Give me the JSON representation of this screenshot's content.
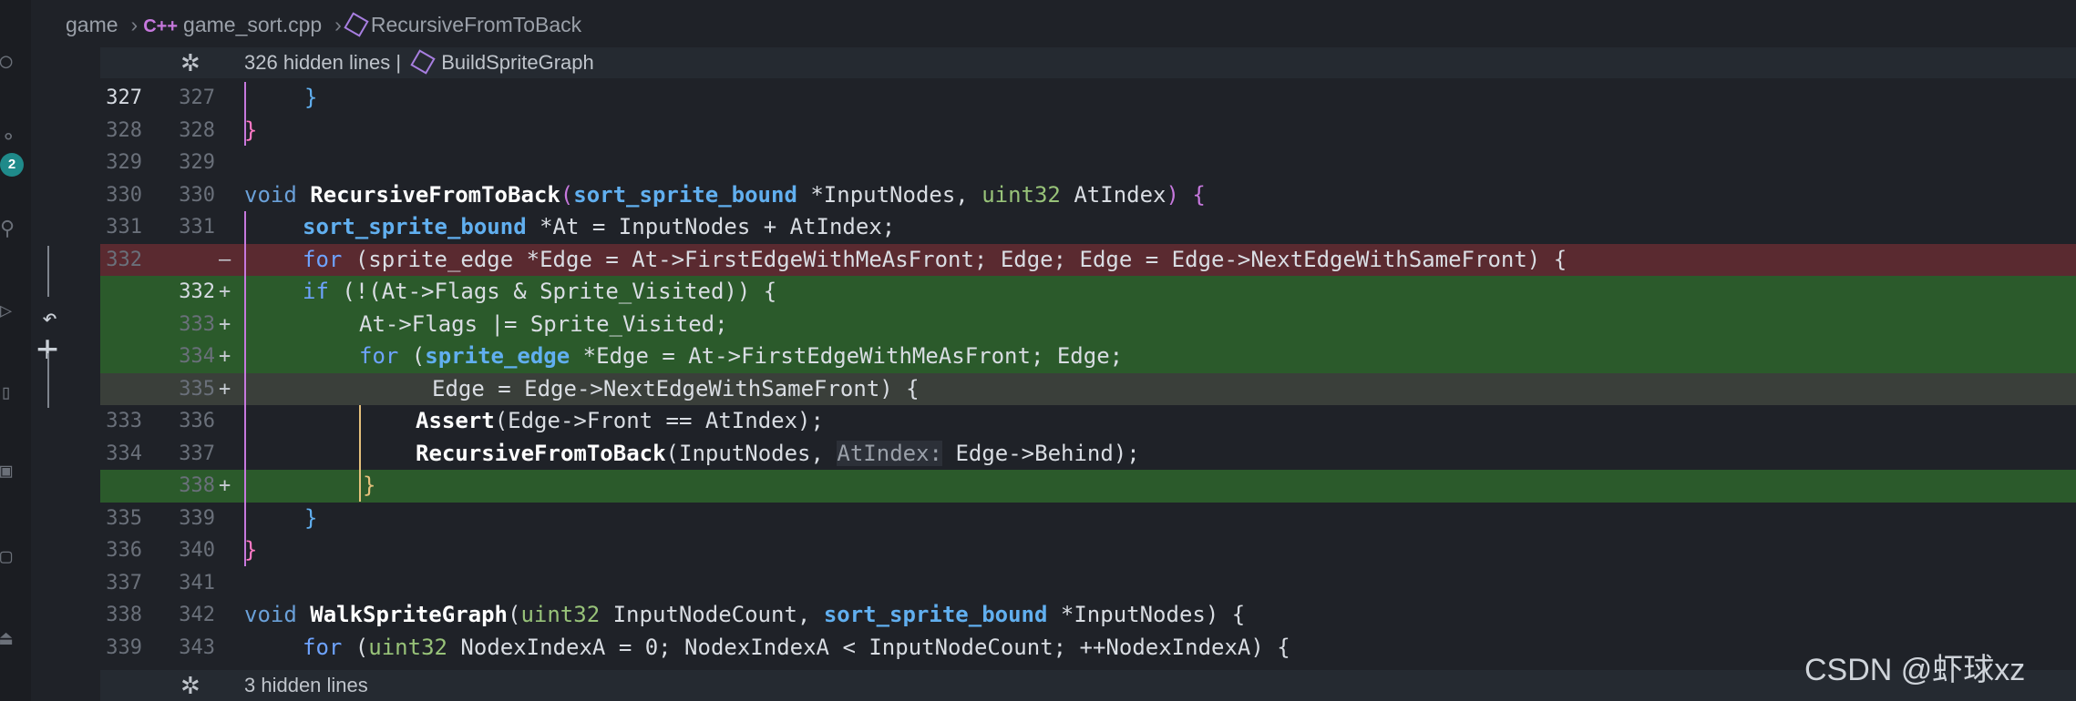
{
  "breadcrumb": {
    "folder": "game",
    "file": "game_sort.cpp",
    "symbol": "RecursiveFromToBack",
    "file_icon": "C++"
  },
  "folds": {
    "top": {
      "text": "326 hidden lines  |",
      "symbol": "BuildSpriteGraph"
    },
    "bottom": {
      "text": "3 hidden lines"
    }
  },
  "activity": {
    "badge_count": "2"
  },
  "lines": [
    {
      "old": "327",
      "new": "327",
      "sign": "",
      "type": "normal",
      "active": true
    },
    {
      "old": "328",
      "new": "328",
      "sign": "",
      "type": "normal"
    },
    {
      "old": "329",
      "new": "329",
      "sign": "",
      "type": "normal"
    },
    {
      "old": "330",
      "new": "330",
      "sign": "",
      "type": "normal"
    },
    {
      "old": "331",
      "new": "331",
      "sign": "",
      "type": "normal"
    },
    {
      "old": "332",
      "new": "",
      "sign": "—",
      "type": "del"
    },
    {
      "old": "",
      "new": "332",
      "sign": "+",
      "type": "add",
      "active": true
    },
    {
      "old": "",
      "new": "333",
      "sign": "+",
      "type": "add"
    },
    {
      "old": "",
      "new": "334",
      "sign": "+",
      "type": "add2"
    },
    {
      "old": "",
      "new": "335",
      "sign": "+",
      "type": "add2"
    },
    {
      "old": "333",
      "new": "336",
      "sign": "",
      "type": "normal"
    },
    {
      "old": "334",
      "new": "337",
      "sign": "",
      "type": "normal"
    },
    {
      "old": "",
      "new": "338",
      "sign": "+",
      "type": "add"
    },
    {
      "old": "335",
      "new": "339",
      "sign": "",
      "type": "normal"
    },
    {
      "old": "336",
      "new": "340",
      "sign": "",
      "type": "normal"
    },
    {
      "old": "337",
      "new": "341",
      "sign": "",
      "type": "normal"
    },
    {
      "old": "338",
      "new": "342",
      "sign": "",
      "type": "normal"
    },
    {
      "old": "339",
      "new": "343",
      "sign": "",
      "type": "normal"
    }
  ],
  "code": {
    "l327": "}",
    "l328": "}",
    "l330_void": "void",
    "l330_fn": "RecursiveFromToBack",
    "l330_t1": "sort_sprite_bound",
    "l330_p1": "*InputNodes,",
    "l330_t2": "uint32",
    "l330_p2": "AtIndex",
    "l331_t": "sort_sprite_bound",
    "l331_rest": "*At = InputNodes + AtIndex;",
    "l332_for": "for",
    "l332_rest": "(sprite_edge *Edge = At->FirstEdgeWithMeAsFront; Edge; Edge = Edge->NextEdgeWithSameFront) {",
    "n332_if": "if",
    "n332_rest": "(!(At->Flags & Sprite_Visited)) {",
    "n333": "At->Flags |= Sprite_Visited;",
    "n334_for": "for",
    "n334_t": "sprite_edge",
    "n334_rest": "*Edge = At->FirstEdgeWithMeAsFront; Edge;",
    "n335": "Edge = Edge->NextEdgeWithSameFront) {",
    "n336_fn": "Assert",
    "n336_rest": "(Edge->Front == AtIndex);",
    "n337_fn": "RecursiveFromToBack",
    "n337_a": "(InputNodes,",
    "n337_hint": "AtIndex:",
    "n337_b": "Edge->Behind);",
    "n338": "}",
    "n339": "}",
    "n340": "}",
    "n342_void": "void",
    "n342_fn": "WalkSpriteGraph",
    "n342_t1": "uint32",
    "n342_p1": "InputNodeCount,",
    "n342_t2": "sort_sprite_bound",
    "n342_p2": "*InputNodes) {",
    "n343_for": "for",
    "n343_t": "uint32",
    "n343_rest": "NodexIndexA = 0; NodexIndexA < InputNodeCount; ++NodexIndexA) {"
  },
  "watermark": "CSDN @虾球xz",
  "colors": {
    "background": "#1f2228",
    "deleted": "#5a2a30",
    "added": "#2b5a2b",
    "keyword": "#6ea3ff",
    "type": "#61afef"
  }
}
